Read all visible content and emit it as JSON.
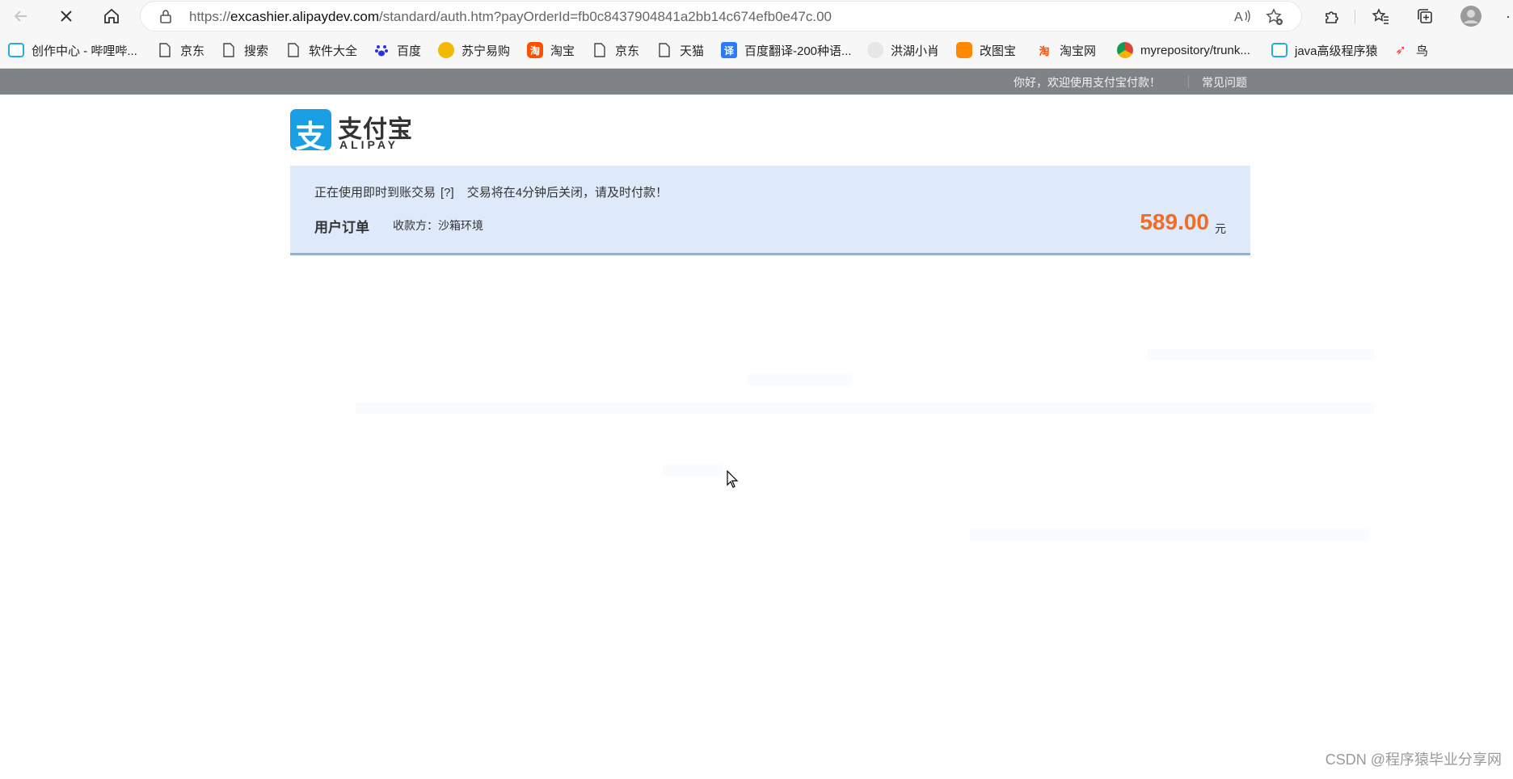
{
  "browser": {
    "url_prefix": "https://",
    "url_host": "excashier.alipaydev.com",
    "url_path": "/standard/auth.htm?payOrderId=fb0c8437904841a2bb14c674efb0e47c.00",
    "bookmarks": [
      {
        "label": "创作中心 - 哔哩哔...",
        "icon": "bilibili-icon"
      },
      {
        "label": "京东",
        "icon": "page-icon"
      },
      {
        "label": "搜索",
        "icon": "page-icon"
      },
      {
        "label": "软件大全",
        "icon": "page-icon"
      },
      {
        "label": "百度",
        "icon": "baidu-icon"
      },
      {
        "label": "苏宁易购",
        "icon": "suning-icon"
      },
      {
        "label": "淘宝",
        "icon": "taobao-icon"
      },
      {
        "label": "京东",
        "icon": "page-icon"
      },
      {
        "label": "天猫",
        "icon": "page-icon"
      },
      {
        "label": "百度翻译-200种语...",
        "icon": "translate-icon"
      },
      {
        "label": "洪湖小肖",
        "icon": "bird-icon"
      },
      {
        "label": "改图宝",
        "icon": "gaitubao-icon"
      },
      {
        "label": "淘宝网",
        "icon": "taobao-icon"
      },
      {
        "label": "myrepository/trunk...",
        "icon": "chrome-icon"
      },
      {
        "label": "java高级程序猿",
        "icon": "bilibili-icon"
      },
      {
        "label": "鸟",
        "icon": "bird-red-icon"
      }
    ]
  },
  "header": {
    "welcome": "你好，欢迎使用支付宝付款！",
    "faq": "常见问题"
  },
  "logo": {
    "cn": "支付宝",
    "en": "ALIPAY",
    "mark": "支"
  },
  "order": {
    "notice": "正在使用即时到账交易",
    "help": "[?]",
    "warning": "交易将在4分钟后关闭，请及时付款！",
    "title": "用户订单",
    "payee": "收款方：沙箱环境",
    "amount": "589.00",
    "unit": "元"
  },
  "watermark": "CSDN @程序猿毕业分享网",
  "colors": {
    "alipay_blue": "#1a9fe4",
    "amount_orange": "#f36c24",
    "panel_bg": "#dee9f9",
    "strip_gray": "#7f8286"
  }
}
